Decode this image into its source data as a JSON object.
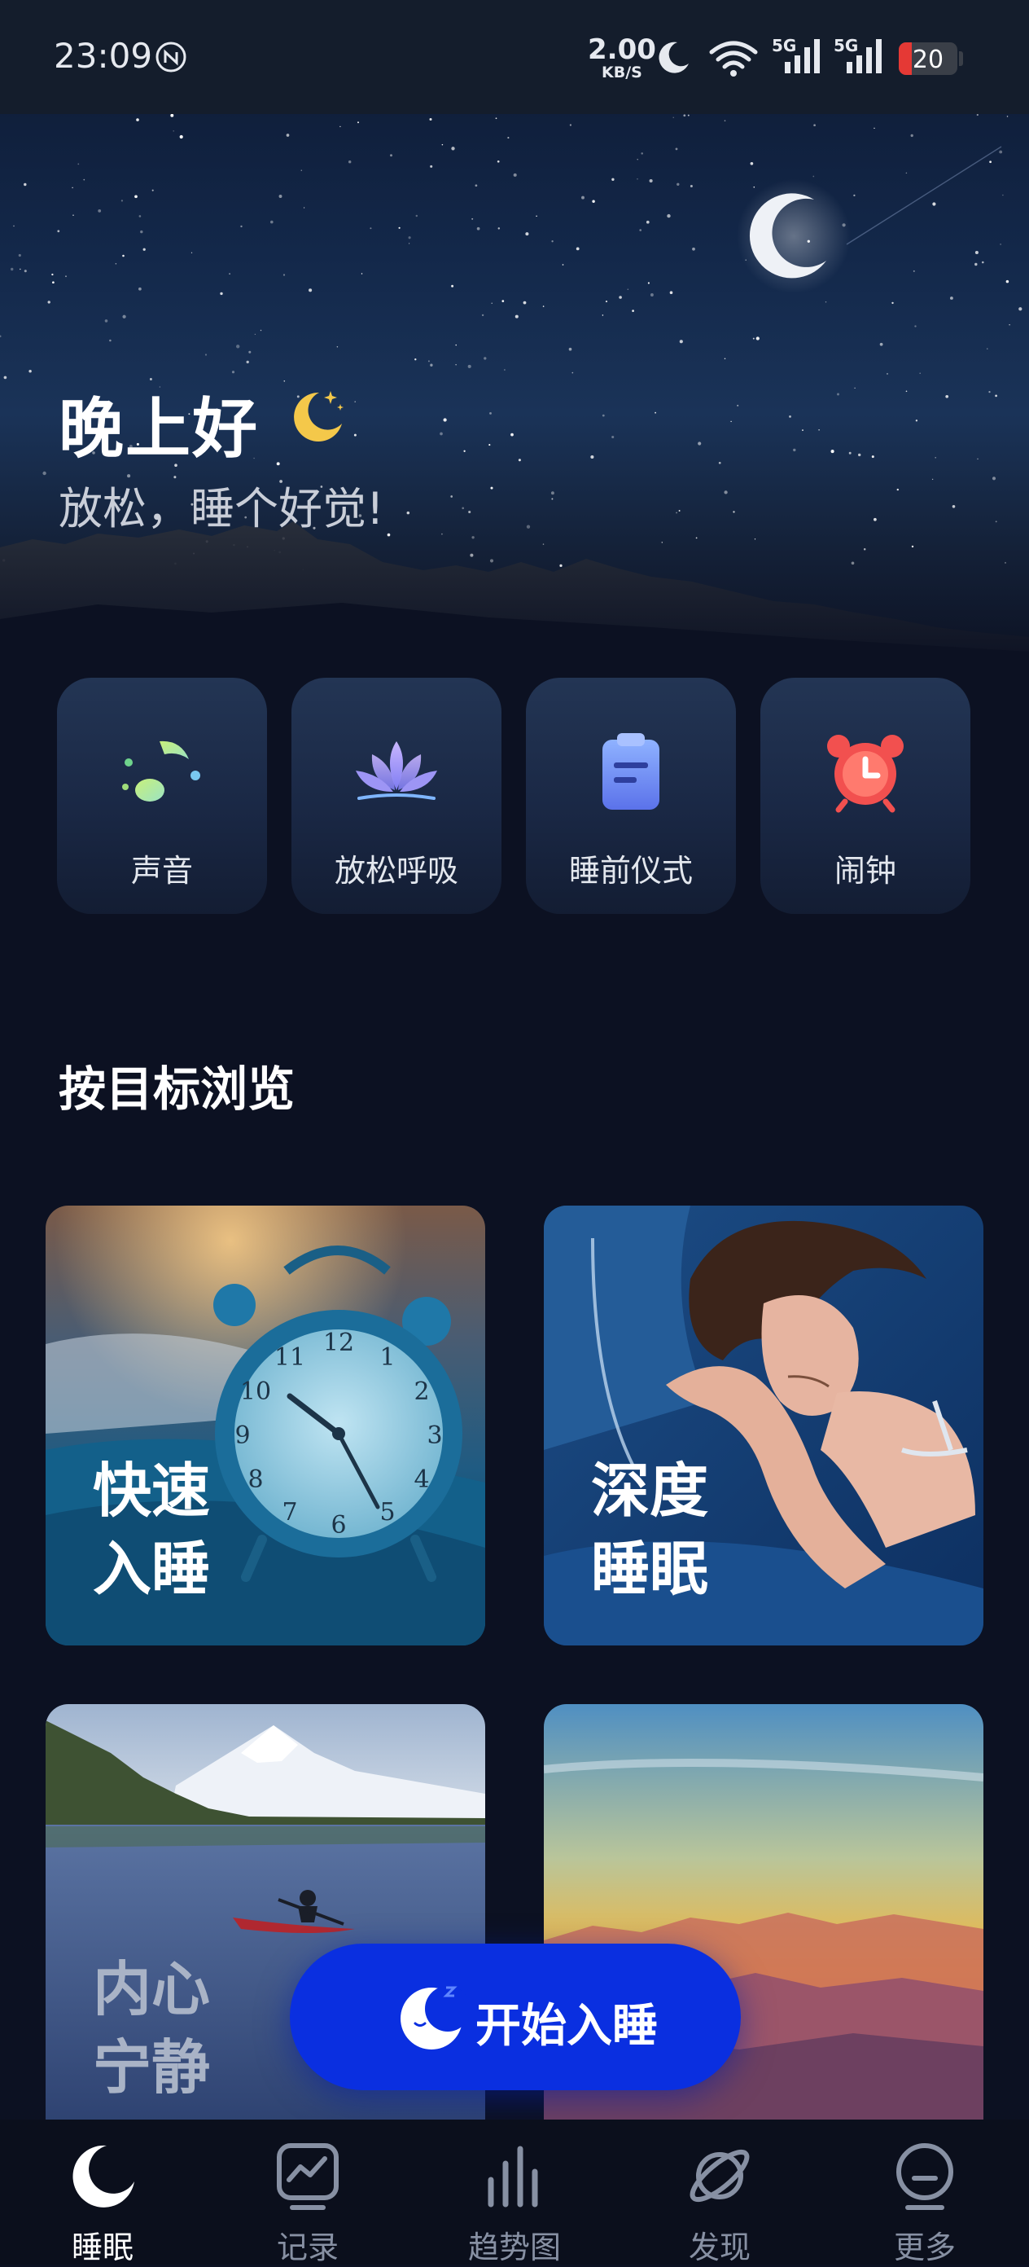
{
  "status_bar": {
    "time": "23:09",
    "net_speed": "2.00",
    "net_speed_unit": "KB/S",
    "signal_1": "5G",
    "signal_2": "5G",
    "battery": "20",
    "icons": [
      "nfc-icon",
      "moon-icon",
      "wifi-icon",
      "signal-icon",
      "battery-icon"
    ]
  },
  "hero": {
    "greeting": "晚上好",
    "subtitle": "放松，睡个好觉!"
  },
  "quick_actions": [
    {
      "label": "声音",
      "icon": "music-note-icon"
    },
    {
      "label": "放松呼吸",
      "icon": "lotus-icon"
    },
    {
      "label": "睡前仪式",
      "icon": "clipboard-icon"
    },
    {
      "label": "闹钟",
      "icon": "alarm-clock-icon"
    }
  ],
  "browse": {
    "title": "按目标浏览",
    "cards": [
      {
        "line1": "快速",
        "line2": "入睡"
      },
      {
        "line1": "深度",
        "line2": "睡眠"
      },
      {
        "line1": "内心",
        "line2": "宁静"
      },
      {
        "line1": "",
        "line2": ""
      }
    ]
  },
  "cta": {
    "label": "开始入睡",
    "icon": "sleep-moon-icon"
  },
  "tabs": [
    {
      "label": "睡眠",
      "icon": "moon-icon",
      "active": true
    },
    {
      "label": "记录",
      "icon": "chart-record-icon",
      "active": false
    },
    {
      "label": "趋势图",
      "icon": "bar-trend-icon",
      "active": false
    },
    {
      "label": "发现",
      "icon": "planet-icon",
      "active": false
    },
    {
      "label": "更多",
      "icon": "face-icon",
      "active": false
    }
  ],
  "colors": {
    "background": "#0c1122",
    "cta": "#0a2fe0",
    "battery_low": "#e53935"
  }
}
